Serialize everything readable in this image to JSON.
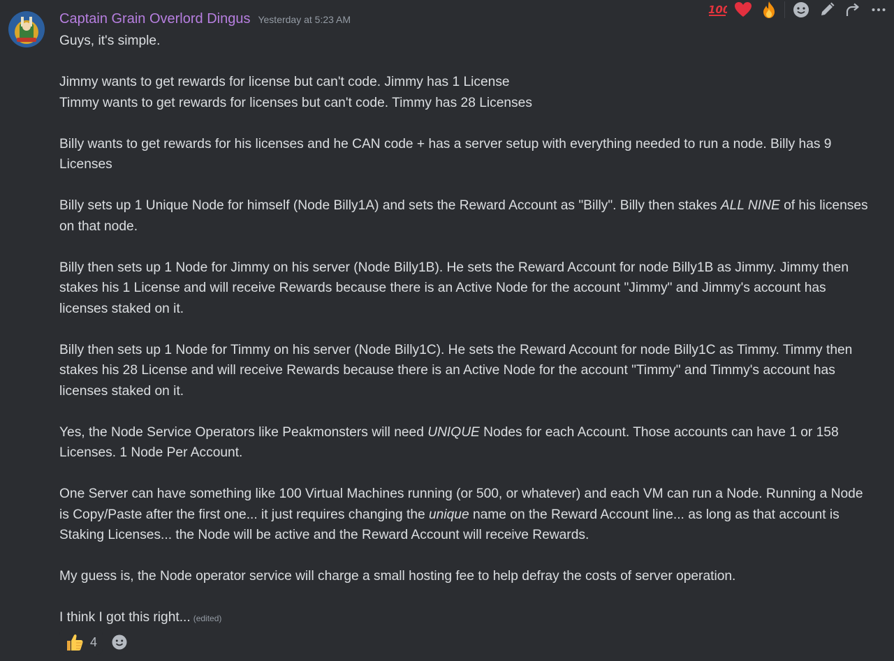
{
  "message": {
    "author": "Captain Grain Overlord Dingus",
    "timestamp": "Yesterday at 5:23 AM",
    "edited_label": "(edited)",
    "paragraphs": [
      {
        "lines": [
          "Guys, it's simple."
        ]
      },
      {
        "lines": [
          "Jimmy wants to get rewards for license but can't code. Jimmy has 1 License",
          "Timmy wants to get rewards for licenses but can't code. Timmy has 28 Licenses"
        ]
      },
      {
        "lines": [
          "Billy wants to get rewards for his licenses and he CAN code + has a server setup with everything needed to run a node. Billy has 9 Licenses"
        ]
      },
      {
        "p4_before": "Billy sets up 1 Unique Node for himself (Node Billy1A) and sets the Reward Account as \"Billy\". Billy then stakes ",
        "p4_em": "ALL NINE",
        "p4_after": " of his licenses on that node."
      },
      {
        "lines": [
          "Billy then sets up 1 Node for Jimmy on his server (Node Billy1B). He sets the Reward Account for node Billy1B as Jimmy. Jimmy then stakes his 1 License and will receive Rewards because there is an Active Node for the account \"Jimmy\" and Jimmy's account has licenses staked on it."
        ]
      },
      {
        "lines": [
          "Billy then sets up 1 Node for Timmy on his server (Node Billy1C). He sets the Reward Account for node Billy1C as Timmy. Timmy then stakes his 28 License and will receive Rewards because there is an Active Node for the account \"Timmy\" and Timmy's account has licenses staked on it."
        ]
      },
      {
        "p7_before": "Yes, the Node Service Operators like Peakmonsters will need ",
        "p7_em": "UNIQUE",
        "p7_after": " Nodes for each Account.  Those accounts can have 1 or 158 Licenses. 1 Node Per Account."
      },
      {
        "p8_before": "One Server can have something like 100 Virtual Machines running (or 500, or whatever) and each VM can run a Node. Running a Node is Copy/Paste after the first one... it just requires changing the ",
        "p8_em": "unique",
        "p8_after": " name on the Reward Account line... as long as that account is Staking Licenses... the Node will be active and the Reward Account will receive Rewards."
      },
      {
        "lines": [
          "My guess is, the Node operator service will charge a small hosting fee to help defray the costs of server operation."
        ]
      },
      {
        "lines": [
          "I think I got this right..."
        ]
      }
    ]
  },
  "toolbar": {
    "icons": [
      "hundred-points-emoji",
      "red-heart-emoji",
      "fire-emoji",
      "add-reaction-icon",
      "edit-pencil-icon",
      "reply-arrow-icon",
      "more-dots-icon"
    ]
  },
  "reactions": [
    {
      "emoji": "thumbs-up-emoji",
      "count": "4"
    }
  ],
  "colors": {
    "username": "#b77fe0",
    "background": "#2b2d31",
    "text": "#dbdee1",
    "muted": "#949ba4"
  }
}
